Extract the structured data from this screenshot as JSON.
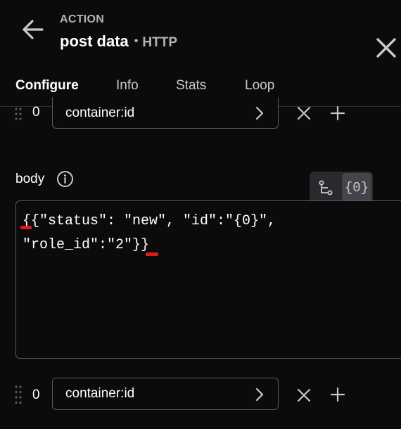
{
  "header": {
    "kicker": "ACTION",
    "title": "post data",
    "separator": "•",
    "protocol": "HTTP"
  },
  "tabs": [
    {
      "label": "Configure",
      "active": true
    },
    {
      "label": "Info",
      "active": false
    },
    {
      "label": "Stats",
      "active": false
    },
    {
      "label": "Loop",
      "active": false
    }
  ],
  "top_row": {
    "index": "0",
    "value": "container:id"
  },
  "body_field": {
    "label": "body",
    "mode_options": [
      "tree-icon",
      "{0}"
    ],
    "active_mode": "{0}",
    "lines": [
      "{{\"status\": \"new\", \"id\":\"{0}\",",
      "\"role_id\":\"2\"}}"
    ],
    "error_color": "#e01b1b"
  },
  "bottom_row": {
    "index": "0",
    "value": "container:id"
  },
  "colors": {
    "background": "#0b0b0c",
    "border": "#5a5a60",
    "muted_text": "#b4b4b8",
    "toggle_bg": "#2a2a2e"
  }
}
